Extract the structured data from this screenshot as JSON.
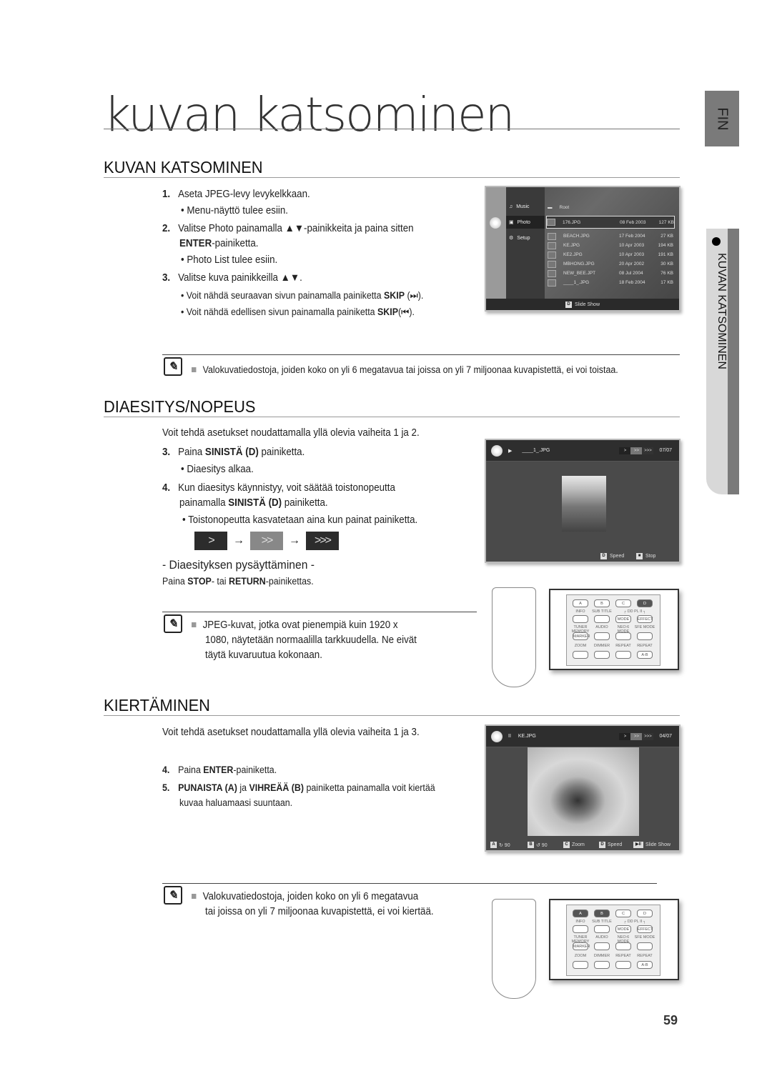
{
  "page": {
    "title": "kuvan katsominen",
    "lang_tab": "FIN",
    "side_tab": "KUVAN KATSOMINEN",
    "page_number": "59"
  },
  "section1": {
    "heading": "KUVAN KATSOMINEN",
    "steps": [
      {
        "num": "1.",
        "text": "Aseta JPEG-levy levykelkkaan."
      },
      {
        "bullet": "Menu-näyttö tulee esiin."
      },
      {
        "num": "2.",
        "text_a": "Valitse Photo painamalla ▲▼-painikkeita ja paina sitten",
        "bold": "ENTER",
        "text_b": "-painiketta."
      },
      {
        "bullet": "Photo List tulee esiin."
      },
      {
        "num": "3.",
        "text": "Valitse kuva painikkeilla ▲▼."
      },
      {
        "bullet_a": "Voit nähdä seuraavan sivun painamalla painiketta ",
        "bold": "SKIP",
        "bullet_b": " (⏭)."
      },
      {
        "bullet_a": "Voit nähdä edellisen sivun painamalla painiketta ",
        "bold": "SKIP",
        "bullet_b": "(⏮)."
      }
    ],
    "note": "Valokuvatiedostoja, joiden koko on yli 6 megatavua tai joissa on yli 7 miljoonaa kuvapistettä, ei voi toistaa.",
    "screen": {
      "nav": [
        "Music",
        "Photo",
        "Setup"
      ],
      "folder": "Root",
      "files": [
        {
          "name": "176.JPG",
          "date": "08 Feb 2003",
          "size": "127 KB"
        },
        {
          "name": "BEACH.JPG",
          "date": "17 Feb 2004",
          "size": "27 KB"
        },
        {
          "name": "KE.JPG",
          "date": "10 Apr 2003",
          "size": "194 KB"
        },
        {
          "name": "KE2.JPG",
          "date": "10 Apr 2003",
          "size": "191 KB"
        },
        {
          "name": "MBHONG.JPG",
          "date": "20 Apr 2002",
          "size": "30 KB"
        },
        {
          "name": "NEW_BEE.JPT",
          "date": "08 Jul 2004",
          "size": "76 KB"
        },
        {
          "name": "____1_.JPG",
          "date": "18 Feb 2004",
          "size": "17 KB"
        }
      ],
      "footer_key": "D",
      "footer_label": "Slide Show",
      "disc_label": "CD"
    }
  },
  "section2": {
    "heading": "DIAESITYS/NOPEUS",
    "intro": "Voit tehdä asetukset noudattamalla yllä olevia vaiheita 1 ja 2.",
    "step3": {
      "num": "3.",
      "a": "Paina ",
      "bold": "SINISTÄ (D)",
      "b": " painiketta."
    },
    "bullet3": "Diaesitys alkaa.",
    "step4": {
      "num": "4.",
      "line1": "Kun diaesitys käynnistyy, voit säätää toistonopeutta",
      "a": "painamalla ",
      "bold": "SINISTÄ (D)",
      "b": " painiketta."
    },
    "bullet4": "Toistonopeutta kasvatetaan aina kun painat painiketta.",
    "speeds": [
      ">",
      ">>",
      ">>>"
    ],
    "arrow": "→",
    "stop_heading": "- Diaesityksen pysäyttäminen -",
    "stop_text": {
      "a": "Paina ",
      "b1": "STOP",
      "m": "- tai ",
      "b2": "RETURN",
      "c": "-painikettas."
    },
    "note": [
      "JPEG-kuvat, jotka ovat pienempiä kuin 1920 x",
      "1080, näytetään normaalilla tarkkuudella. Ne eivät",
      "täytä kuvaruutua kokonaan."
    ],
    "screen": {
      "state_icon": "play",
      "filename": "____1_.JPG",
      "speeds": [
        ">",
        ">>",
        ">>>"
      ],
      "counter": "07/07",
      "foot": [
        {
          "key": "D",
          "label": "Speed"
        },
        {
          "key": "■",
          "label": "Stop"
        }
      ]
    }
  },
  "section3": {
    "heading": "KIERTÄMINEN",
    "intro": "Voit tehdä asetukset noudattamalla yllä olevia vaiheita 1 ja 3.",
    "step4": {
      "num": "4.",
      "a": "Paina ",
      "bold": "ENTER",
      "b": "-painiketta."
    },
    "step5": {
      "num": "5.",
      "bold1": "PUNAISTA (A)",
      "m": " ja ",
      "bold2": "VIHREÄÄ (B)",
      "b": " painiketta painamalla voit kiertää",
      "line2": "kuvaa haluamaasi suuntaan."
    },
    "note": [
      "Valokuvatiedostoja, joiden koko on yli 6 megatavua",
      "tai joissa on yli 7 miljoonaa kuvapistettä, ei voi kiertää."
    ],
    "screen": {
      "state_icon": "pause",
      "filename": "KE.JPG",
      "speeds": [
        ">",
        ">>",
        ">>>"
      ],
      "counter": "04/07",
      "foot": [
        {
          "key": "A",
          "label": "↻ 90"
        },
        {
          "key": "B",
          "label": "↺ 90"
        },
        {
          "key": "C",
          "label": "Zoom"
        },
        {
          "key": "D",
          "label": "Speed"
        },
        {
          "key": "▶II",
          "label": "Slide Show"
        }
      ]
    }
  },
  "remote": {
    "color_keys": [
      "A",
      "B",
      "C",
      "D"
    ],
    "row2_labels": [
      "INFO",
      "SUB TITLE",
      "┌ DD PL II ┐",
      ""
    ],
    "row2_buttons": [
      "",
      "",
      "MODE",
      "EFFECT"
    ],
    "row3_labels": [
      "TUNER MEMORY",
      "AUDIO",
      "NEO:6 MODE",
      "SFE MODE"
    ],
    "row3_buttons": [
      "MARKER",
      "",
      "",
      ""
    ],
    "row4_labels": [
      "ZOOM",
      "DIMMER",
      "REPEAT",
      "REPEAT"
    ],
    "row4_buttons": [
      "",
      "",
      "",
      "A-B"
    ]
  }
}
